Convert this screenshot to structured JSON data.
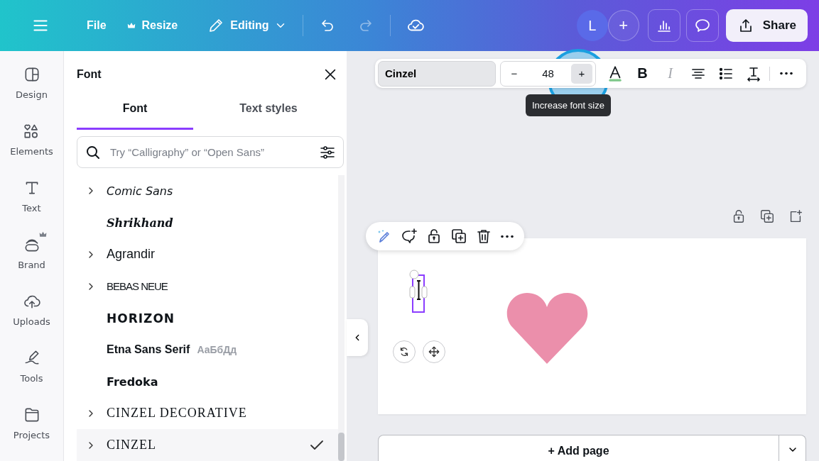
{
  "topbar": {
    "file": "File",
    "resize": {
      "label": "Resize",
      "premium": true
    },
    "mode": "Editing",
    "undo": {
      "disabled": false
    },
    "redo": {
      "disabled": true
    },
    "avatar": "L",
    "invite": "+",
    "share": "Share"
  },
  "rail": [
    {
      "label": "Design",
      "premium": false
    },
    {
      "label": "Elements",
      "premium": false
    },
    {
      "label": "Text",
      "premium": false
    },
    {
      "label": "Brand",
      "premium": true
    },
    {
      "label": "Uploads",
      "premium": false
    },
    {
      "label": "Tools",
      "premium": false
    },
    {
      "label": "Projects",
      "premium": false
    }
  ],
  "panel": {
    "title": "Font",
    "tabs": [
      {
        "label": "Font",
        "selected": true
      },
      {
        "label": "Text styles",
        "selected": false
      }
    ],
    "search": {
      "placeholder": "Try “Calligraphy” or “Open Sans”"
    },
    "fonts": [
      {
        "name": "Comic Sans",
        "kind": "script",
        "expandable": true,
        "selected": false
      },
      {
        "name": "Shrikhand",
        "kind": "display",
        "expandable": false,
        "selected": false
      },
      {
        "name": "Agrandir",
        "kind": "light",
        "expandable": true,
        "selected": false
      },
      {
        "name": "BEBAS NEUE",
        "kind": "condensed",
        "expandable": true,
        "selected": false
      },
      {
        "name": "HORIZON",
        "kind": "wide",
        "expandable": false,
        "selected": false
      },
      {
        "name": "Etna Sans Serif",
        "kind": "bold",
        "expandable": false,
        "selected": false,
        "preview": "АаБбДд"
      },
      {
        "name": "Fredoka",
        "kind": "rounded",
        "expandable": false,
        "selected": false
      },
      {
        "name": "CINZEL DECORATIVE",
        "kind": "serif",
        "expandable": true,
        "selected": false
      },
      {
        "name": "CINZEL",
        "kind": "serif",
        "expandable": true,
        "selected": true
      }
    ]
  },
  "toolbar": {
    "font": "Cinzel",
    "decrease": "−",
    "size": "48",
    "increase": "+",
    "tooltip": "Increase font size",
    "bold": "B",
    "italic": {
      "label": "I",
      "disabled": true
    }
  },
  "canvas": {
    "add_page": "+ Add page"
  }
}
